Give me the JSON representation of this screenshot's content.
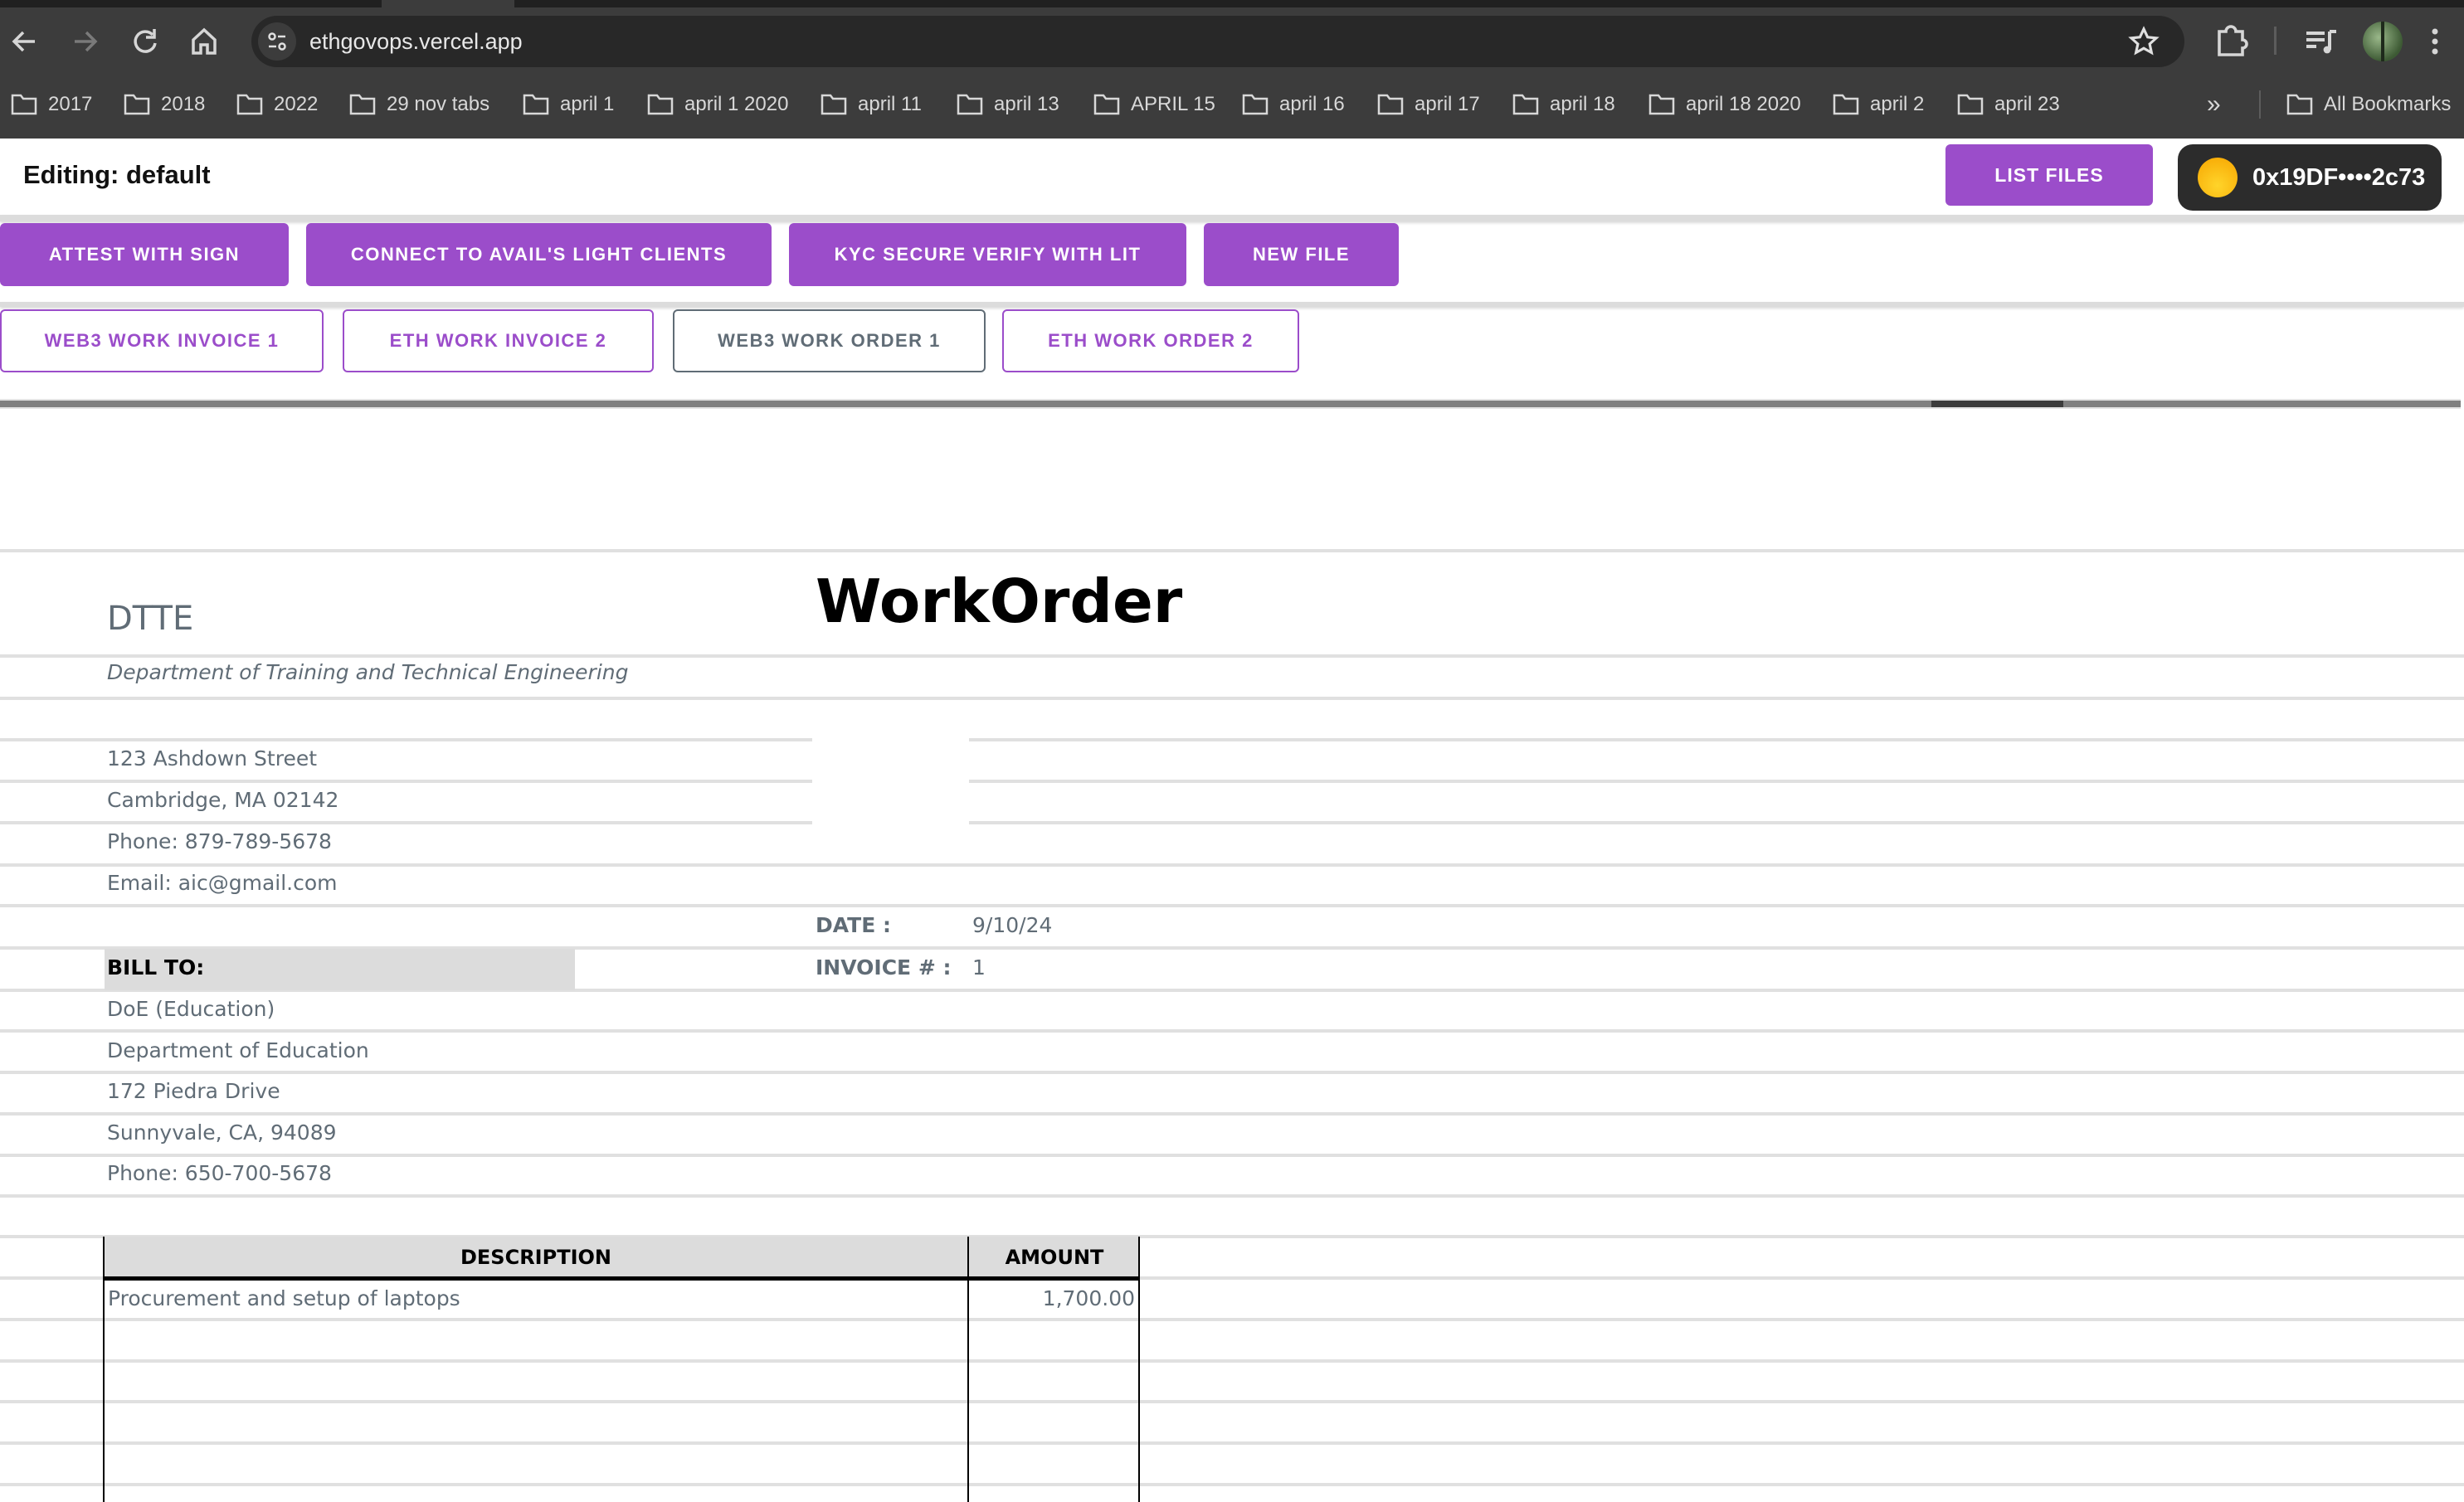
{
  "browser": {
    "url": "ethgovops.vercel.app",
    "bookmarks": [
      "2017",
      "2018",
      "2022",
      "29 nov tabs",
      "april 1",
      "april 1 2020",
      "april 11",
      "april 13",
      "APRIL 15",
      "april 16",
      "april 17",
      "april 18",
      "april 18 2020",
      "april 2",
      "april 23"
    ],
    "bookmarks_overflow": "»",
    "all_bookmarks_label": "All Bookmarks"
  },
  "header": {
    "editing_label": "Editing: default",
    "list_files_label": "LIST FILES",
    "wallet_address": "0x19DF••••2c73"
  },
  "actions": [
    {
      "label": "ATTEST WITH SIGN"
    },
    {
      "label": "CONNECT TO AVAIL'S LIGHT CLIENTS"
    },
    {
      "label": "KYC SECURE VERIFY WITH LIT"
    },
    {
      "label": "NEW FILE"
    }
  ],
  "sheet_tabs": [
    {
      "label": "WEB3 WORK INVOICE 1",
      "selected": false
    },
    {
      "label": "ETH WORK INVOICE 2",
      "selected": false
    },
    {
      "label": "WEB3 WORK ORDER 1",
      "selected": true
    },
    {
      "label": "ETH WORK ORDER 2",
      "selected": false
    }
  ],
  "colors": {
    "accent": "#9b4dca",
    "selected_tab": "#606c76",
    "text_muted": "#606c76",
    "wallet_bg": "#2c2c2c"
  },
  "document": {
    "title": "WorkOrder",
    "company": {
      "name": "DTTE",
      "tagline": "Department of Training and Technical Engineering",
      "street": "123 Ashdown Street",
      "city": "Cambridge, MA 02142",
      "phone": "Phone: 879-789-5678",
      "email": "Email: aic@gmail.com"
    },
    "meta": {
      "date_label": "DATE :",
      "date_value": "9/10/24",
      "invoice_label": "INVOICE # :",
      "invoice_value": "1"
    },
    "bill_to": {
      "label": "BILL TO:",
      "name": "DoE (Education)",
      "org": "Department of Education",
      "street": "172 Piedra Drive",
      "city": "Sunnyvale, CA, 94089",
      "phone": "Phone: 650-700-5678"
    },
    "items": {
      "headers": {
        "description": "DESCRIPTION",
        "amount": "AMOUNT"
      },
      "rows": [
        {
          "description": "Procurement and setup of laptops",
          "amount": "1,700.00"
        },
        {
          "description": "",
          "amount": ""
        },
        {
          "description": "",
          "amount": ""
        },
        {
          "description": "",
          "amount": ""
        },
        {
          "description": "",
          "amount": ""
        }
      ]
    }
  }
}
